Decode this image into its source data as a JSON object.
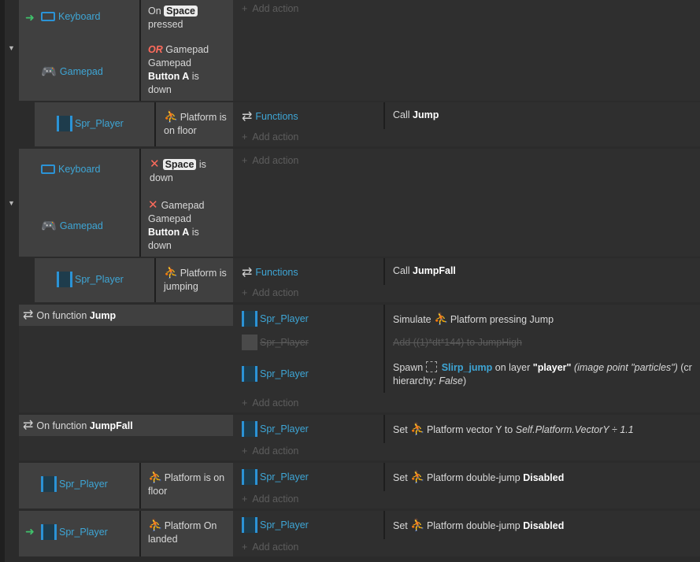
{
  "events": {
    "e1": {
      "keyboard_label": "Keyboard",
      "on_text": "On",
      "key_space": "Space",
      "pressed_text": "pressed",
      "gamepad_label": "Gamepad",
      "or_text": "OR",
      "gp_text_1": "Gamepad",
      "gp_text_2": "Gamepad",
      "gp_button": "Button A",
      "gp_is": "is",
      "gp_down": "down",
      "add_action": "Add action"
    },
    "e1sub": {
      "object": "Spr_Player",
      "cond_text": "Platform is on floor",
      "action_object": "Functions",
      "call_text": "Call",
      "call_name": "Jump",
      "add_action": "Add action"
    },
    "e2": {
      "keyboard_label": "Keyboard",
      "key_space": "Space",
      "is_down": "is down",
      "gamepad_label": "Gamepad",
      "gp_text_1": "Gamepad",
      "gp_text_2": "Gamepad",
      "gp_button": "Button A",
      "gp_is": "is",
      "gp_down": "down",
      "add_action": "Add action"
    },
    "e2sub": {
      "object": "Spr_Player",
      "cond_text": "Platform is jumping",
      "action_object": "Functions",
      "call_text": "Call",
      "call_name": "JumpFall",
      "add_action": "Add action"
    },
    "e3": {
      "on_function": "On function",
      "fn_name": "Jump",
      "a1_object": "Spr_Player",
      "a1_simulate": "Simulate",
      "a1_rest": "Platform pressing Jump",
      "a2_object": "Spr_Player",
      "a2_text": "Add ((1)*dt*144) to JumpHigh",
      "a3_object": "Spr_Player",
      "a3_spawn": "Spawn",
      "a3_sprite": "Slirp_jump",
      "a3_on_layer": "on layer",
      "a3_layer": "\"player\"",
      "a3_imagepoint": "(image point \"particles\")",
      "a3_cr": "(cr",
      "a3_hierarchy": "hierarchy:",
      "a3_false": "False",
      "a3_close": ")",
      "add_action": "Add action"
    },
    "e4": {
      "on_function": "On function",
      "fn_name": "JumpFall",
      "a1_object": "Spr_Player",
      "a1_set": "Set",
      "a1_rest": "Platform vector Y to",
      "a1_expr": "Self.Platform.VectorY ÷ 1.1",
      "add_action": "Add action"
    },
    "e5": {
      "object": "Spr_Player",
      "cond_text": "Platform is on floor",
      "a1_object": "Spr_Player",
      "a1_set": "Set",
      "a1_rest": "Platform double-jump",
      "a1_value": "Disabled",
      "add_action": "Add action"
    },
    "e6": {
      "object": "Spr_Player",
      "cond_text": "Platform On landed",
      "a1_object": "Spr_Player",
      "a1_set": "Set",
      "a1_rest": "Platform double-jump",
      "a1_value": "Disabled",
      "add_action": "Add action"
    }
  },
  "colors": {
    "accent": "#3ea6d6",
    "warning": "#ff6b5c",
    "trigger": "#3fc26b"
  }
}
